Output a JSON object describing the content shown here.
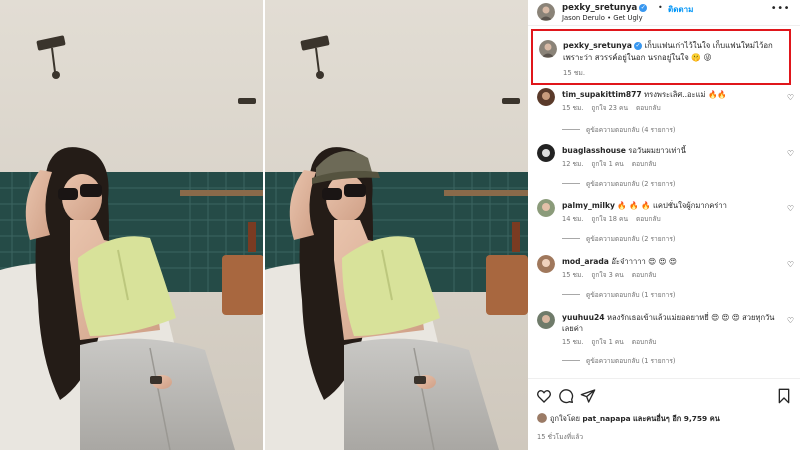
{
  "post": {
    "username": "pexky_sretunya",
    "follow_label": "ติดตาม",
    "dot": "•",
    "song": "Jason Derulo • Get Ugly",
    "more_label": "•••",
    "caption": {
      "username": "pexky_sretunya",
      "text": "เก็บแฟนเก่าไว้ในใจ เก็บแฟนใหม่ไว้อก เพราะว่า สวรรค์อยู่ในอก นรกอยู่ในใจ 🤫 😜",
      "time": "15 ชม."
    }
  },
  "comments": [
    {
      "username": "tim_supakittim877",
      "text": "ทรงพระเลิศ..อะแม่ 🔥🔥",
      "time": "15 ชม.",
      "likes": "ถูกใจ 23 คน",
      "reply": "ตอบกลับ",
      "replies": "ดูข้อความตอบกลับ (4 รายการ)"
    },
    {
      "username": "buaglasshouse",
      "text": "รอวันผมยาวเท่านี้",
      "time": "12 ชม.",
      "likes": "ถูกใจ 1 คน",
      "reply": "ตอบกลับ",
      "replies": "ดูข้อความตอบกลับ (2 รายการ)"
    },
    {
      "username": "palmy_milky",
      "text": "🔥 🔥 🔥 แคปชั่นใจผู้กมากคร่าา",
      "time": "14 ชม.",
      "likes": "ถูกใจ 18 คน",
      "reply": "ตอบกลับ",
      "replies": "ดูข้อความตอบกลับ (2 รายการ)"
    },
    {
      "username": "mod_arada",
      "text": "อ๊ะจ๋าาาาา 😍 😍 😍",
      "time": "15 ชม.",
      "likes": "ถูกใจ 3 คน",
      "reply": "ตอบกลับ",
      "replies": "ดูข้อความตอบกลับ (1 รายการ)"
    },
    {
      "username": "yuuhuu24",
      "text": "หลงรักเธอเข้าแล้วแม่ยอดยาหยี่ 😍 😍 😍 สวยทุกวันเลยค่า",
      "time": "15 ชม.",
      "likes": "ถูกใจ 1 คน",
      "reply": "ตอบกลับ",
      "replies": "ดูข้อความตอบกลับ (1 รายการ)"
    }
  ],
  "footer": {
    "liked_by_prefix": "ถูกใจโดย",
    "liked_by_user": "pat_napapa",
    "liked_by_suffix": "และคนอื่นๆ อีก 9,759 คน",
    "posted": "15 ชั่วโมงที่แล้ว"
  },
  "icons": {
    "like": "heart-outline-icon",
    "comment": "speech-bubble-icon",
    "share": "paper-plane-icon",
    "save": "bookmark-icon",
    "comment_like": "small-heart-icon"
  },
  "colors": {
    "accent": "#0095f6",
    "highlight_box": "#e0161b",
    "verified": "#3897f0",
    "secondary_text": "#737373"
  }
}
